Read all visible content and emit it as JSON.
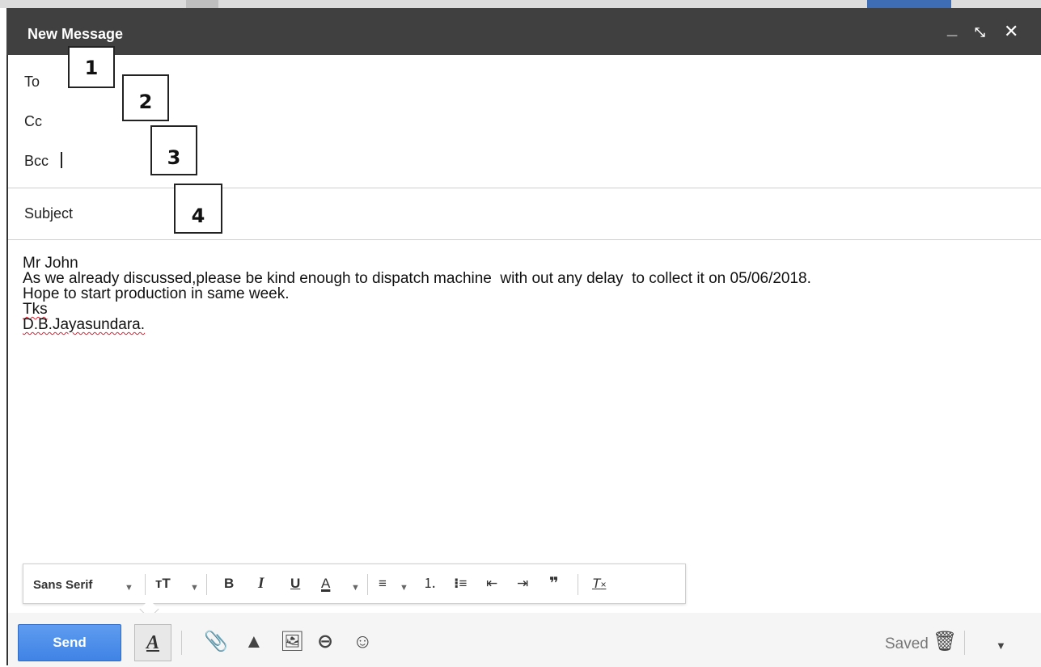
{
  "window": {
    "title": "New Message"
  },
  "fields": {
    "to_label": "To",
    "cc_label": "Cc",
    "bcc_label": "Bcc",
    "subject_label": "Subject"
  },
  "callouts": [
    "1",
    "2",
    "3",
    "4"
  ],
  "message": {
    "lines": [
      "Mr John",
      "As we already discussed,please be kind enough to dispatch machine  with out any delay  to collect it on 05/06/2018.",
      "Hope to start production in same week.",
      "Tks",
      "D.B.Jayasundara."
    ]
  },
  "format_toolbar": {
    "font_label": "Sans Serif",
    "icons": [
      "font-size-icon",
      "bold-icon",
      "italic-icon",
      "underline-icon",
      "text-color-icon",
      "align-icon",
      "numbered-list-icon",
      "bulleted-list-icon",
      "indent-less-icon",
      "indent-more-icon",
      "quote-icon",
      "remove-formatting-icon"
    ]
  },
  "bottom_toolbar": {
    "send_label": "Send",
    "saved_label": "Saved",
    "icons": [
      "formatting-options-icon",
      "attach-icon",
      "drive-icon",
      "photo-icon",
      "link-icon",
      "emoji-icon",
      "trash-icon",
      "more-options-icon"
    ]
  },
  "colors": {
    "titlebar": "#404040",
    "send_button": "#4a8af0",
    "spell_underline": "#dd2233"
  }
}
